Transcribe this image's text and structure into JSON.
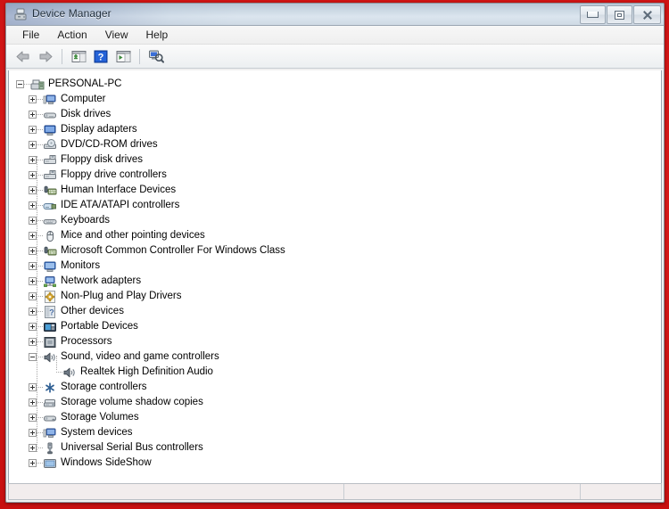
{
  "window": {
    "title": "Device Manager",
    "title_icon": "device-manager-icon",
    "buttons": {
      "minimize": "Minimize",
      "maximize": "Maximize",
      "close": "Close"
    }
  },
  "menubar": {
    "items": [
      {
        "label": "File",
        "name": "menu-file"
      },
      {
        "label": "Action",
        "name": "menu-action"
      },
      {
        "label": "View",
        "name": "menu-view"
      },
      {
        "label": "Help",
        "name": "menu-help"
      }
    ]
  },
  "toolbar": {
    "items": [
      {
        "name": "back-button",
        "icon": "back-arrow-icon",
        "label": "Back"
      },
      {
        "name": "forward-button",
        "icon": "forward-arrow-icon",
        "label": "Forward"
      },
      {
        "name": "show-hide-console-tree-button",
        "icon": "console-tree-icon",
        "label": "Show/Hide Console Tree"
      },
      {
        "name": "help-button",
        "icon": "help-question-icon",
        "label": "Help"
      },
      {
        "name": "properties-button",
        "icon": "properties-icon",
        "label": "Properties"
      },
      {
        "name": "scan-hardware-changes-button",
        "icon": "scan-hardware-icon",
        "label": "Scan for hardware changes"
      }
    ]
  },
  "tree": {
    "root": {
      "label": "PERSONAL-PC",
      "icon": "computer-root-icon",
      "expanded": true
    },
    "nodes": [
      {
        "label": "Computer",
        "icon": "computer-icon",
        "expanded": false,
        "level": 1
      },
      {
        "label": "Disk drives",
        "icon": "disk-drive-icon",
        "expanded": false,
        "level": 1
      },
      {
        "label": "Display adapters",
        "icon": "display-adapter-icon",
        "expanded": false,
        "level": 1
      },
      {
        "label": "DVD/CD-ROM drives",
        "icon": "dvd-cdrom-icon",
        "expanded": false,
        "level": 1
      },
      {
        "label": "Floppy disk drives",
        "icon": "floppy-disk-icon",
        "expanded": false,
        "level": 1
      },
      {
        "label": "Floppy drive controllers",
        "icon": "floppy-controller-icon",
        "expanded": false,
        "level": 1
      },
      {
        "label": "Human Interface Devices",
        "icon": "hid-icon",
        "expanded": false,
        "level": 1
      },
      {
        "label": "IDE ATA/ATAPI controllers",
        "icon": "ide-controller-icon",
        "expanded": false,
        "level": 1
      },
      {
        "label": "Keyboards",
        "icon": "keyboard-icon",
        "expanded": false,
        "level": 1
      },
      {
        "label": "Mice and other pointing devices",
        "icon": "mouse-icon",
        "expanded": false,
        "level": 1
      },
      {
        "label": "Microsoft Common Controller For Windows Class",
        "icon": "hid-icon",
        "expanded": false,
        "level": 1
      },
      {
        "label": "Monitors",
        "icon": "monitor-icon",
        "expanded": false,
        "level": 1
      },
      {
        "label": "Network adapters",
        "icon": "network-adapter-icon",
        "expanded": false,
        "level": 1
      },
      {
        "label": "Non-Plug and Play Drivers",
        "icon": "gear-driver-icon",
        "expanded": false,
        "level": 1
      },
      {
        "label": "Other devices",
        "icon": "other-device-icon",
        "expanded": false,
        "level": 1
      },
      {
        "label": "Portable Devices",
        "icon": "portable-device-icon",
        "expanded": false,
        "level": 1
      },
      {
        "label": "Processors",
        "icon": "processor-icon",
        "expanded": false,
        "level": 1
      },
      {
        "label": "Sound, video and game controllers",
        "icon": "speaker-icon",
        "expanded": true,
        "level": 1
      },
      {
        "label": "Realtek High Definition Audio",
        "icon": "speaker-icon",
        "expanded": null,
        "level": 2
      },
      {
        "label": "Storage controllers",
        "icon": "storage-controller-icon",
        "expanded": false,
        "level": 1
      },
      {
        "label": "Storage volume shadow copies",
        "icon": "shadow-copy-icon",
        "expanded": false,
        "level": 1
      },
      {
        "label": "Storage Volumes",
        "icon": "storage-volume-icon",
        "expanded": false,
        "level": 1
      },
      {
        "label": "System devices",
        "icon": "system-device-icon",
        "expanded": false,
        "level": 1
      },
      {
        "label": "Universal Serial Bus controllers",
        "icon": "usb-icon",
        "expanded": false,
        "level": 1
      },
      {
        "label": "Windows SideShow",
        "icon": "sideshow-icon",
        "expanded": false,
        "level": 1
      }
    ]
  },
  "statusbar": {
    "pane_main": "",
    "pane_second": "",
    "pane_third": ""
  },
  "colors": {
    "desktop": "#d31717",
    "titlebar": "#c9d6e2",
    "client_bg": "#ffffff",
    "statusbar": "#f2eded"
  }
}
